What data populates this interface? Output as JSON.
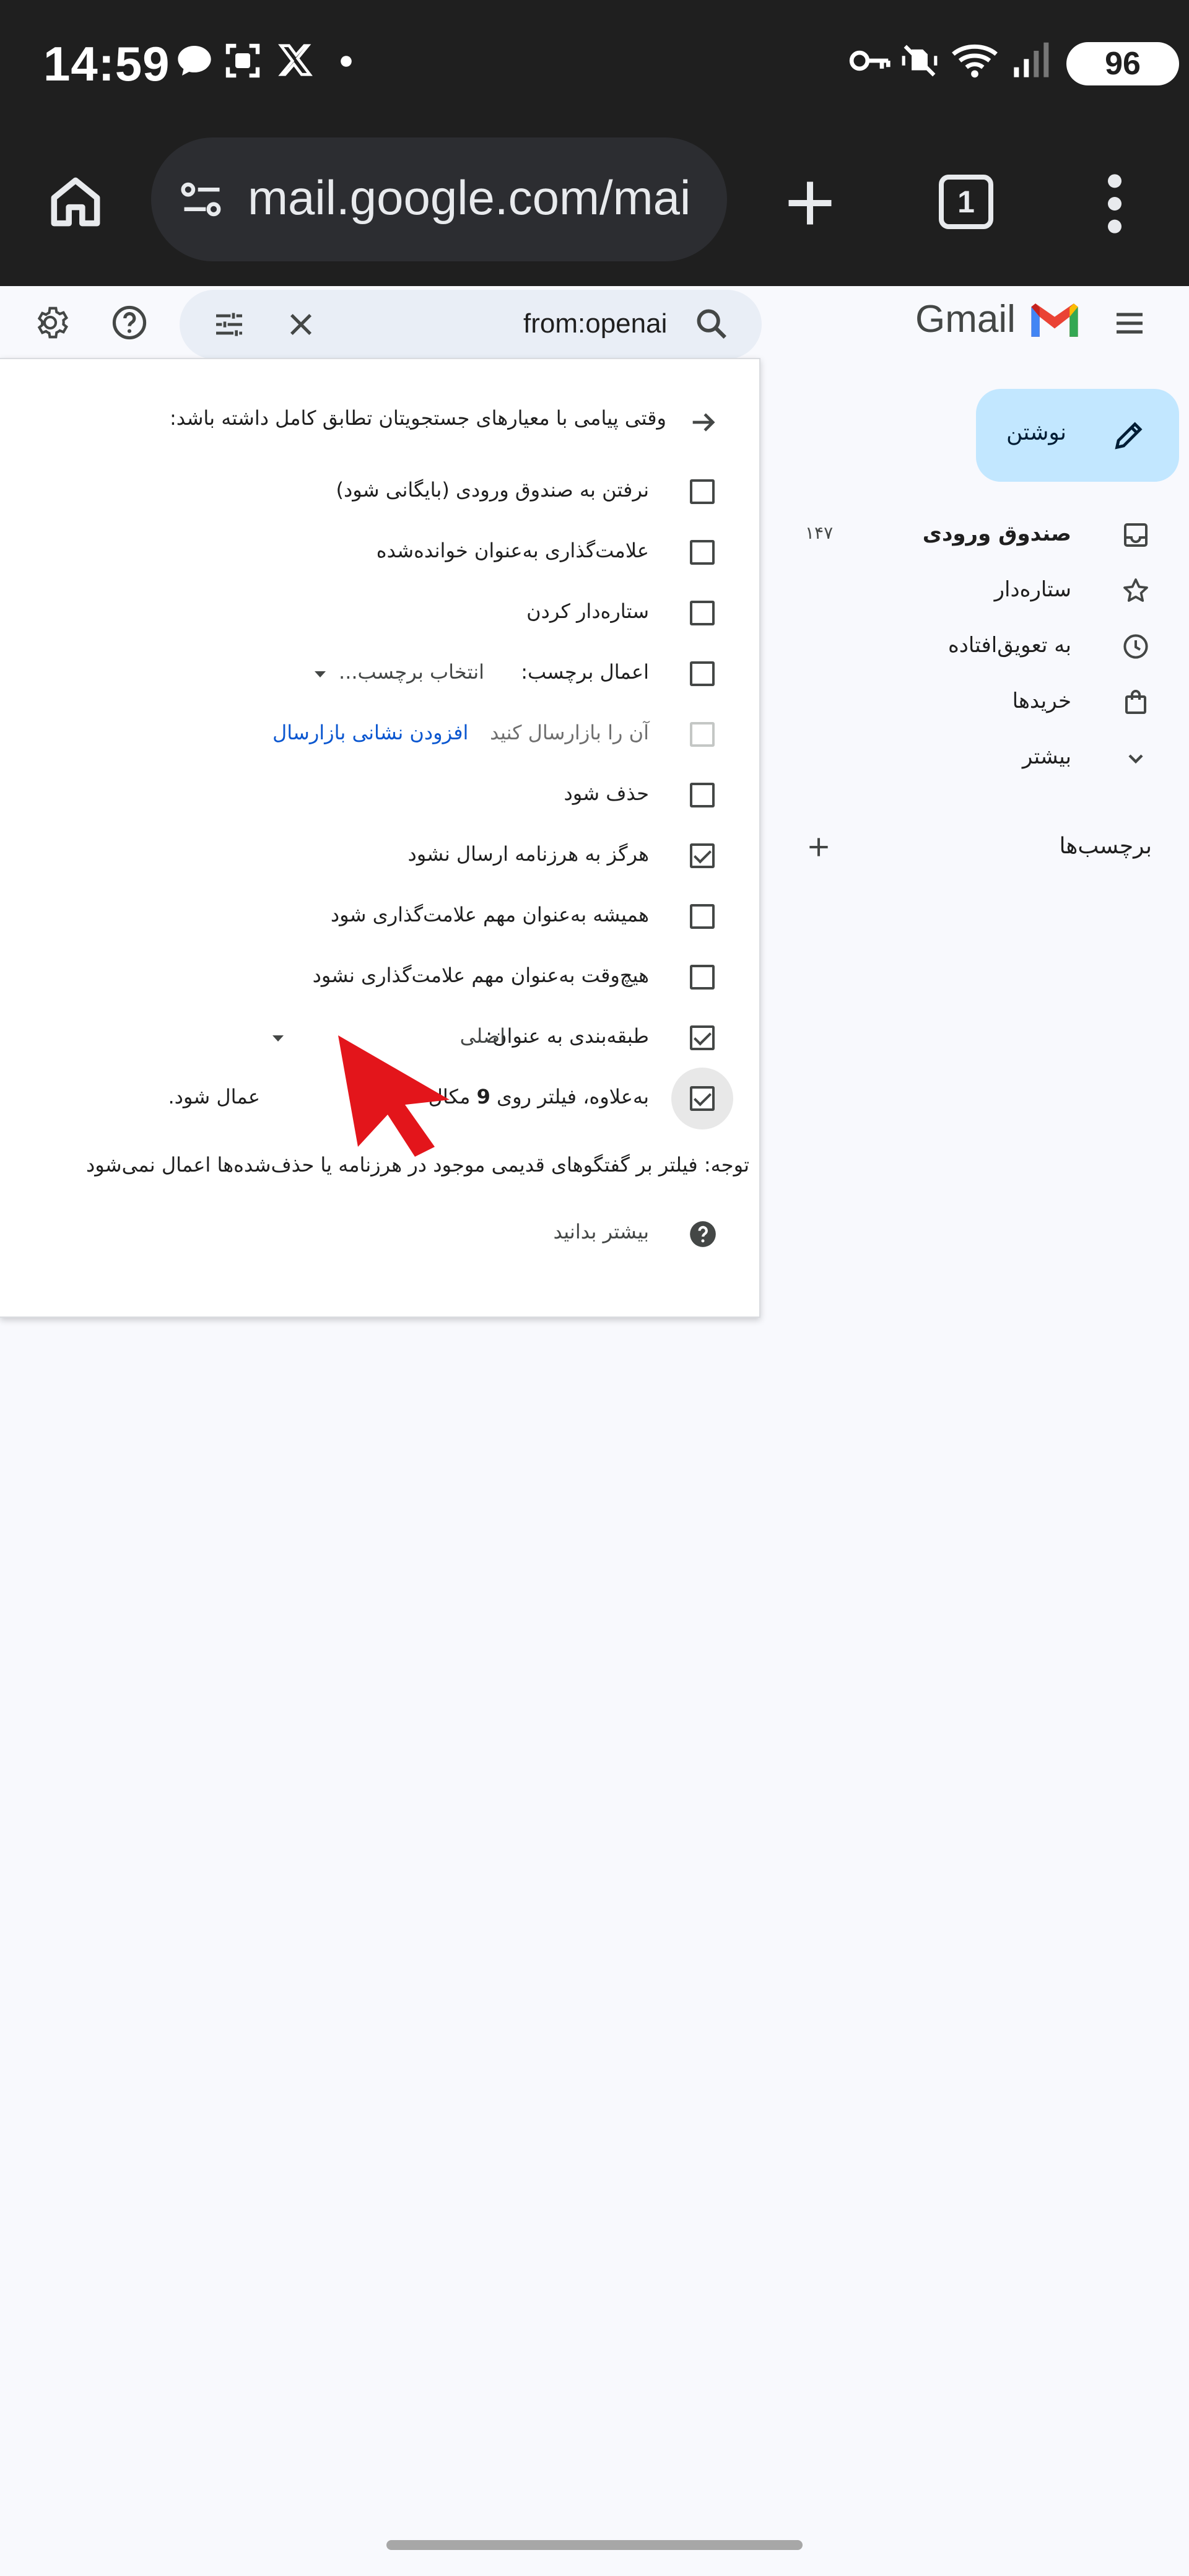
{
  "status_bar": {
    "time": "14:59",
    "battery": "96",
    "left_icons": [
      "chat-bubble-icon",
      "screenshot-icon",
      "x-logo-icon",
      "dot-icon"
    ],
    "right_icons": [
      "key-icon",
      "vibrate-icon",
      "wifi-icon",
      "signal-icon"
    ]
  },
  "browser": {
    "url": "mail.google.com/mai",
    "tab_count": "1",
    "icons": [
      "home-icon",
      "site-settings-icon",
      "new-tab-icon",
      "tab-switcher-icon",
      "more-menu-icon"
    ]
  },
  "gmail": {
    "logo_text": "Gmail",
    "search_query": "from:openai",
    "header_icons": [
      "settings-icon",
      "help-icon",
      "search-options-icon",
      "clear-search-icon",
      "search-icon",
      "main-menu-icon"
    ]
  },
  "nav": {
    "compose_label": "نوشتن",
    "items": [
      {
        "label": "صندوق ورودی",
        "count": "۱۴۷",
        "icon": "inbox-icon",
        "bold": true
      },
      {
        "label": "ستاره‌دار",
        "count": "",
        "icon": "star-icon",
        "bold": false
      },
      {
        "label": "به تعویق‌افتاده",
        "count": "",
        "icon": "clock-icon",
        "bold": false
      },
      {
        "label": "خریدها",
        "count": "",
        "icon": "shopping-bag-icon",
        "bold": false
      },
      {
        "label": "بیشتر",
        "count": "",
        "icon": "chevron-down-icon",
        "bold": false
      }
    ],
    "labels_title": "برچسب‌ها"
  },
  "filter": {
    "header": "وقتی پیامی با معیارهای جستجویتان تطابق کامل داشته باشد:",
    "options": [
      {
        "label": "نرفتن به صندوق ورودی (بایگانی شود)",
        "checked": false
      },
      {
        "label": "علامت‌گذاری به‌عنوان خوانده‌شده",
        "checked": false
      },
      {
        "label": "ستاره‌دار کردن",
        "checked": false
      },
      {
        "label": "اعمال برچسب:",
        "checked": false,
        "select": "انتخاب برچسب..."
      },
      {
        "label": "آن را بازارسال کنید",
        "checked": false,
        "disabled": true,
        "link": "افزودن نشانی بازارسال"
      },
      {
        "label": "حذف شود",
        "checked": false
      },
      {
        "label": "هرگز به هرزنامه ارسال نشود",
        "checked": true
      },
      {
        "label": "همیشه به‌عنوان مهم علامت‌گذاری شود",
        "checked": false
      },
      {
        "label": "هیچ‌وقت به‌عنوان مهم علامت‌گذاری نشود",
        "checked": false
      },
      {
        "label": "طبقه‌بندی به عنوان:",
        "checked": true,
        "select": "اصلی"
      }
    ],
    "also_apply": {
      "prefix": "به‌علاوه، فیلتر روی",
      "count": "9",
      "suffix_visible": "مکال",
      "tail_visible": "عمال شود.",
      "checked": true
    },
    "note": "توجه: فیلتر بر گفتگوهای قدیمی موجود در هرزنامه یا حذف‌شده‌ها اعمال نمی‌شود",
    "learn_more": "بیشتر بدانید"
  },
  "colors": {
    "status_bg": "#1f1f1f",
    "search_bg": "#e9eef6",
    "compose_bg": "#c2e7ff",
    "link_blue": "#0b57d0",
    "cursor_red": "#e3151b"
  }
}
